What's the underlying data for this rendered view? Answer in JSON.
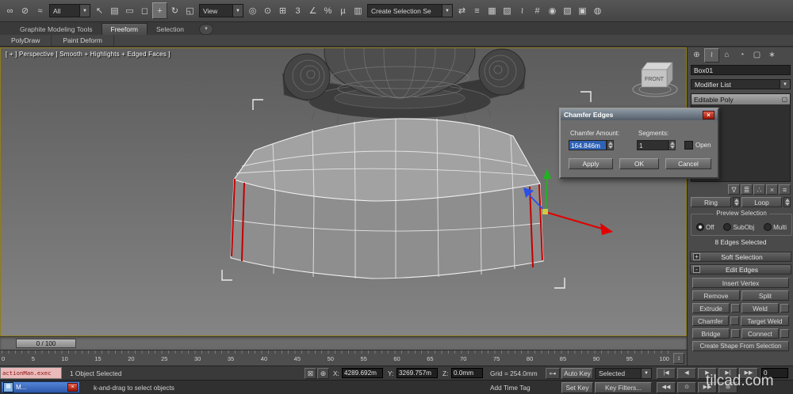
{
  "toolbar": {
    "filter_dropdown": "All",
    "coord_dropdown": "View",
    "selection_set_dropdown": "Create Selection Se",
    "groups": {
      "link": [
        {
          "name": "select-and-link-icon",
          "glyph": "∞"
        },
        {
          "name": "unlink-selection-icon",
          "glyph": "⊘"
        },
        {
          "name": "bind-to-spacewarp-icon",
          "glyph": "≈"
        }
      ],
      "select": [
        {
          "name": "select-object-icon",
          "glyph": "↖"
        },
        {
          "name": "select-by-name-icon",
          "glyph": "▤"
        },
        {
          "name": "selection-region-icon",
          "glyph": "▭"
        },
        {
          "name": "window-crossing-icon",
          "glyph": "◻"
        },
        {
          "name": "select-and-move-icon",
          "glyph": "+",
          "active": true
        },
        {
          "name": "select-and-rotate-icon",
          "glyph": "↻"
        },
        {
          "name": "select-and-scale-icon",
          "glyph": "◱"
        }
      ],
      "snap": [
        {
          "name": "use-center-icon",
          "glyph": "◎"
        },
        {
          "name": "select-and-manipulate-icon",
          "glyph": "⊙"
        },
        {
          "name": "keyboard-override-icon",
          "glyph": "⊞"
        },
        {
          "name": "snap-toggle-icon",
          "glyph": "3"
        },
        {
          "name": "angle-snap-icon",
          "glyph": "∠"
        },
        {
          "name": "percent-snap-icon",
          "glyph": "%"
        },
        {
          "name": "spinner-snap-icon",
          "glyph": "µ"
        },
        {
          "name": "edit-named-sets-icon",
          "glyph": "▥"
        }
      ],
      "render": [
        {
          "name": "mirror-icon",
          "glyph": "⇄"
        },
        {
          "name": "align-icon",
          "glyph": "≡"
        },
        {
          "name": "layer-manager-icon",
          "glyph": "▦"
        },
        {
          "name": "ribbon-toggle-icon",
          "glyph": "▨"
        },
        {
          "name": "curve-editor-icon",
          "glyph": "≀"
        },
        {
          "name": "schematic-view-icon",
          "glyph": "#"
        },
        {
          "name": "material-editor-icon",
          "glyph": "◉"
        },
        {
          "name": "render-setup-icon",
          "glyph": "▧"
        },
        {
          "name": "rendered-frame-icon",
          "glyph": "▣"
        },
        {
          "name": "render-production-icon",
          "glyph": "◍"
        }
      ]
    }
  },
  "ribbon": {
    "tabs": [
      {
        "label": "Graphite Modeling Tools",
        "active": false
      },
      {
        "label": "Freeform",
        "active": true
      },
      {
        "label": "Selection",
        "active": false
      }
    ],
    "panels": [
      "PolyDraw",
      "Paint Deform"
    ],
    "minimize_glyph": "▾"
  },
  "viewport": {
    "label": "[ + ] Perspective ] Smooth + Highlights + Edged Faces ]",
    "viewcube_label": "FRONT"
  },
  "dialog": {
    "title": "Chamfer Edges",
    "close_glyph": "×",
    "amount_label": "Chamfer Amount:",
    "amount_value": "164.846m",
    "segments_label": "Segments:",
    "segments_value": "1",
    "open_label": "Open",
    "apply_label": "Apply",
    "ok_label": "OK",
    "cancel_label": "Cancel"
  },
  "panel": {
    "tabs": [
      {
        "name": "create-tab",
        "glyph": "⊕"
      },
      {
        "name": "modify-tab",
        "glyph": "≀",
        "active": true
      },
      {
        "name": "hierarchy-tab",
        "glyph": "⌂"
      },
      {
        "name": "motion-tab",
        "glyph": "◔"
      },
      {
        "name": "display-tab",
        "glyph": "▢"
      },
      {
        "name": "utilities-tab",
        "glyph": "∗"
      }
    ],
    "object_name": "Box01",
    "modifier_list_label": "Modifier List",
    "stack_item": "Editable Poly",
    "stack_item_icon": "▢",
    "stack_tools": [
      {
        "name": "pin-stack-icon",
        "glyph": "∇"
      },
      {
        "name": "show-end-result-icon",
        "glyph": "≣"
      },
      {
        "name": "make-unique-icon",
        "glyph": "∴"
      },
      {
        "name": "remove-modifier-icon",
        "glyph": "×"
      },
      {
        "name": "configure-modifier-sets-icon",
        "glyph": "≡"
      }
    ],
    "ring_label": "Ring",
    "loop_label": "Loop",
    "preview_title": "Preview Selection",
    "preview_options": [
      {
        "label": "Off",
        "selected": true
      },
      {
        "label": "SubObj",
        "selected": false
      },
      {
        "label": "Multi",
        "selected": false
      }
    ],
    "selection_status": "8 Edges Selected",
    "soft_selection_title": "Soft Selection",
    "soft_plus": "+",
    "edit_edges_title": "Edit Edges",
    "edit_minus": "-",
    "buttons": {
      "insert_vertex": "Insert Vertex",
      "remove": "Remove",
      "split": "Split",
      "extrude": "Extrude",
      "weld": "Weld",
      "chamfer": "Chamfer",
      "target_weld": "Target Weld",
      "bridge": "Bridge",
      "connect": "Connect",
      "create_shape": "Create Shape From Selection"
    }
  },
  "timeline": {
    "slider_value": "0 / 100",
    "ticks": [
      "0",
      "5",
      "10",
      "15",
      "20",
      "25",
      "30",
      "35",
      "40",
      "45",
      "50",
      "55",
      "60",
      "65",
      "70",
      "75",
      "80",
      "85",
      "90",
      "95",
      "100"
    ],
    "trackbar_button_glyph": "↕"
  },
  "status": {
    "listener_text": "actionMan.exec",
    "selection_status": "1 Object Selected",
    "prompt": "k-and-drag to select objects",
    "lock_glyph": "⊠",
    "absolute_glyph": "⊕",
    "x_label": "X:",
    "x_value": "4289.692m",
    "y_label": "Y:",
    "y_value": "3269.757m",
    "z_label": "Z:",
    "z_value": "0.0mm",
    "grid_text": "Grid = 254.0mm",
    "add_time_tag": "Add Time Tag",
    "key_glyph": "⊶",
    "auto_key_label": "Auto Key",
    "set_key_label": "Set Key",
    "selected_value": "Selected",
    "key_filters_label": "Key Filters...",
    "taskbar_label": "M...",
    "taskbar_close_glyph": "×",
    "current_frame": "0"
  },
  "playback": {
    "row1": [
      {
        "name": "go-to-start-button",
        "glyph": "|◀"
      },
      {
        "name": "previous-frame-button",
        "glyph": "◀"
      },
      {
        "name": "play-button",
        "glyph": "▶"
      },
      {
        "name": "next-frame-button",
        "glyph": "▶|"
      },
      {
        "name": "go-to-end-button",
        "glyph": "▶▶"
      }
    ],
    "row2": [
      {
        "name": "previous-key-button",
        "glyph": "◀◀"
      },
      {
        "name": "key-mode-toggle",
        "glyph": "⊙"
      },
      {
        "name": "next-key-button",
        "glyph": "▶▶"
      },
      {
        "name": "time-configuration-button",
        "glyph": "⊞"
      }
    ]
  },
  "watermark": "tilcad.com",
  "colors": {
    "selected_field_bg": "#2f62b5",
    "selected_edge": "#c40000",
    "close_button": "#c0392b",
    "viewport_border": "#8f7d1e"
  }
}
